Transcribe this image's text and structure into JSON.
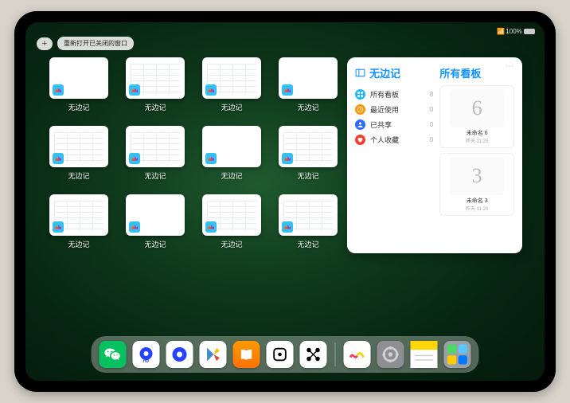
{
  "status": {
    "right": "100%"
  },
  "topbar": {
    "plus": "+",
    "reopen_label": "重新打开已关闭的窗口"
  },
  "thumb_label": "无边记",
  "thumbnails": [
    {
      "style": "blank"
    },
    {
      "style": "lines"
    },
    {
      "style": "lines"
    },
    {
      "style": "blank"
    },
    {
      "style": "lines"
    },
    {
      "style": "lines"
    },
    {
      "style": "blank"
    },
    {
      "style": "lines"
    },
    {
      "style": "lines"
    },
    {
      "style": "blank"
    },
    {
      "style": "lines"
    },
    {
      "style": "lines"
    }
  ],
  "panel": {
    "title": "无边记",
    "right_title": "所有看板",
    "nav": [
      {
        "icon": "grid",
        "color": "#1fb6ff",
        "label": "所有看板",
        "count": "8"
      },
      {
        "icon": "clock",
        "color": "#ff9500",
        "label": "最近使用",
        "count": "0"
      },
      {
        "icon": "person",
        "color": "#2e6bff",
        "label": "已共享",
        "count": "0"
      },
      {
        "icon": "heart",
        "color": "#ff3b30",
        "label": "个人收藏",
        "count": "0"
      }
    ],
    "boards": [
      {
        "glyph": "6",
        "name": "未命名 6",
        "sub": "昨天 11:25"
      },
      {
        "glyph": "3",
        "name": "未命名 3",
        "sub": "昨天 11:20"
      }
    ]
  },
  "dock": {
    "apps": [
      {
        "name": "wechat",
        "bg": "#07c160",
        "svg": "wechat"
      },
      {
        "name": "quark-hd",
        "bg": "#fff",
        "svg": "quark-hd"
      },
      {
        "name": "quark",
        "bg": "#fff",
        "svg": "quark"
      },
      {
        "name": "play",
        "bg": "#fff",
        "svg": "play"
      },
      {
        "name": "books",
        "bg": "linear-gradient(#ff9a00,#ff7200)",
        "svg": "books"
      },
      {
        "name": "dice",
        "bg": "#fff",
        "svg": "dice"
      },
      {
        "name": "nodes",
        "bg": "#fff",
        "svg": "nodes"
      }
    ],
    "recent": [
      {
        "name": "freeform",
        "bg": "#fff",
        "svg": "freeform"
      },
      {
        "name": "settings",
        "bg": "#8e8e93",
        "svg": "settings"
      },
      {
        "name": "notes",
        "bg": "#fff",
        "svg": "notes"
      },
      {
        "name": "app-library",
        "bg": "#9aa0a6",
        "svg": "library"
      }
    ]
  }
}
